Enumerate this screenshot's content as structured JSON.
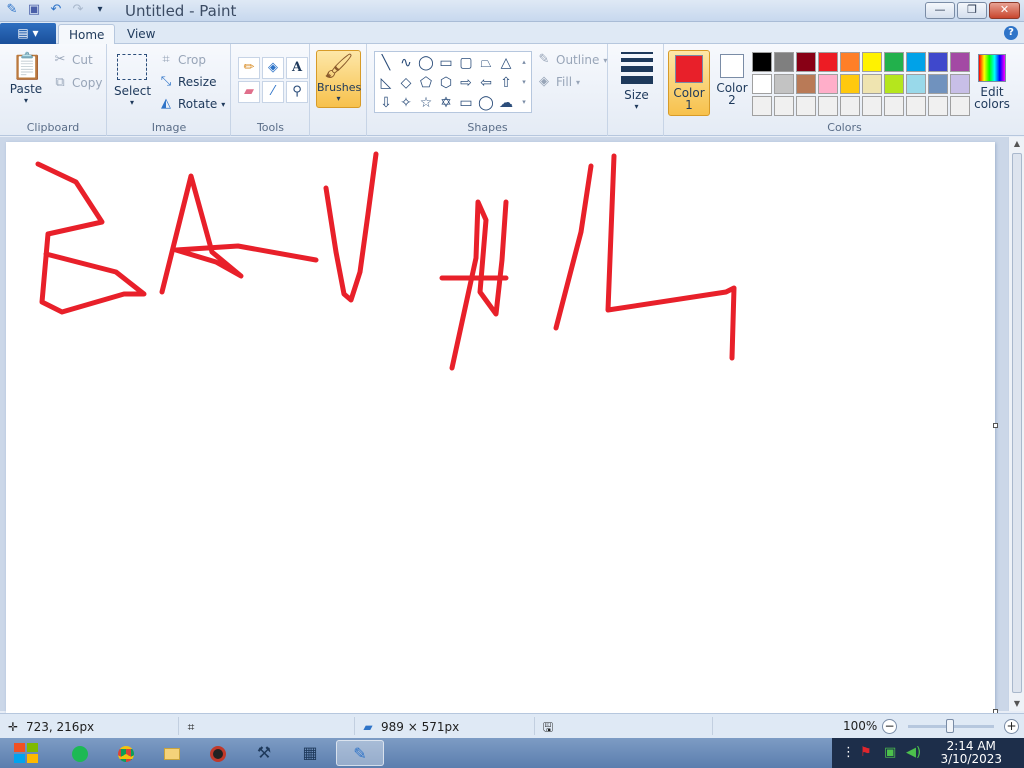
{
  "window": {
    "title": "Untitled - Paint",
    "minimize": "—",
    "restore": "❐",
    "close": "✕"
  },
  "tabs": {
    "file_icon": "▤ ▾",
    "home": "Home",
    "view": "View",
    "help": "?"
  },
  "clipboard": {
    "paste": "Paste",
    "cut": "Cut",
    "copy": "Copy",
    "label": "Clipboard"
  },
  "image": {
    "select": "Select",
    "crop": "Crop",
    "resize": "Resize",
    "rotate": "Rotate",
    "label": "Image"
  },
  "tools": {
    "label": "Tools"
  },
  "brushes": {
    "label": "Brushes"
  },
  "shapes": {
    "outline": "Outline",
    "fill": "Fill",
    "label": "Shapes"
  },
  "size": {
    "label": "Size"
  },
  "colors": {
    "color1_label_line1": "Color",
    "color1_label_line2": "1",
    "color2_label_line1": "Color",
    "color2_label_line2": "2",
    "color1_value": "#e8202a",
    "color2_value": "#ffffff",
    "edit_line1": "Edit",
    "edit_line2": "colors",
    "label": "Colors",
    "palette": [
      "#000000",
      "#7f7f7f",
      "#880015",
      "#ed1c24",
      "#ff7f27",
      "#fff200",
      "#22b14c",
      "#00a2e8",
      "#3f48cc",
      "#a349a4",
      "#ffffff",
      "#c3c3c3",
      "#b97a57",
      "#ffaec9",
      "#ffc90e",
      "#efe4b0",
      "#b5e61d",
      "#99d9ea",
      "#7092be",
      "#c8bfe7",
      "#f0f0f0",
      "#f0f0f0",
      "#f0f0f0",
      "#f0f0f0",
      "#f0f0f0",
      "#f0f0f0",
      "#f0f0f0",
      "#f0f0f0",
      "#f0f0f0",
      "#f0f0f0"
    ]
  },
  "statusbar": {
    "cursor_pos": "723, 216px",
    "canvas_size": "989 × 571px",
    "zoom": "100%"
  },
  "taskbar": {
    "time": "2:14 AM",
    "date": "3/10/2023"
  }
}
